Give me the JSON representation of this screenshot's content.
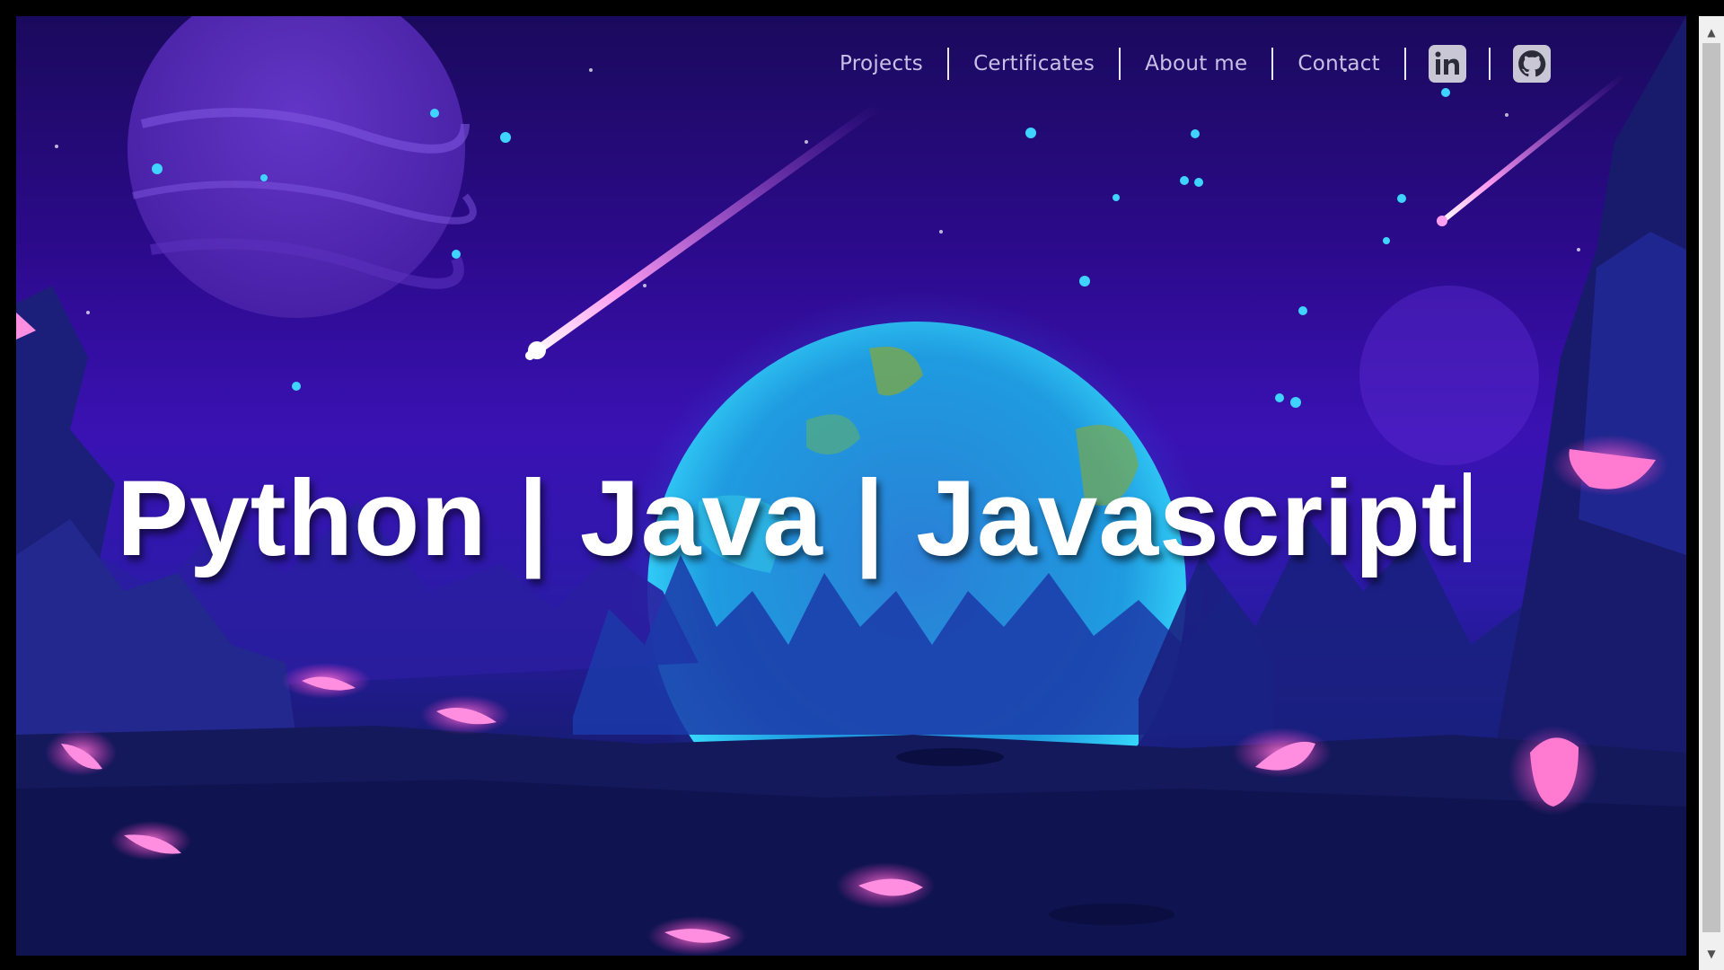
{
  "nav": {
    "links": [
      {
        "label": "Projects"
      },
      {
        "label": "Certificates"
      },
      {
        "label": "About me"
      },
      {
        "label": "Contact"
      }
    ],
    "icons": [
      {
        "name": "linkedin-icon"
      },
      {
        "name": "github-icon"
      }
    ]
  },
  "hero": {
    "headline": "Python | Java | Javascript"
  },
  "colors": {
    "nav_text": "#c9c0e8",
    "headline": "#ffffff",
    "sky_top": "#1a0a5c",
    "sky_mid": "#3a12b4",
    "planet_glow": "#2bd0ff",
    "crystal": "#ff5fc8"
  }
}
